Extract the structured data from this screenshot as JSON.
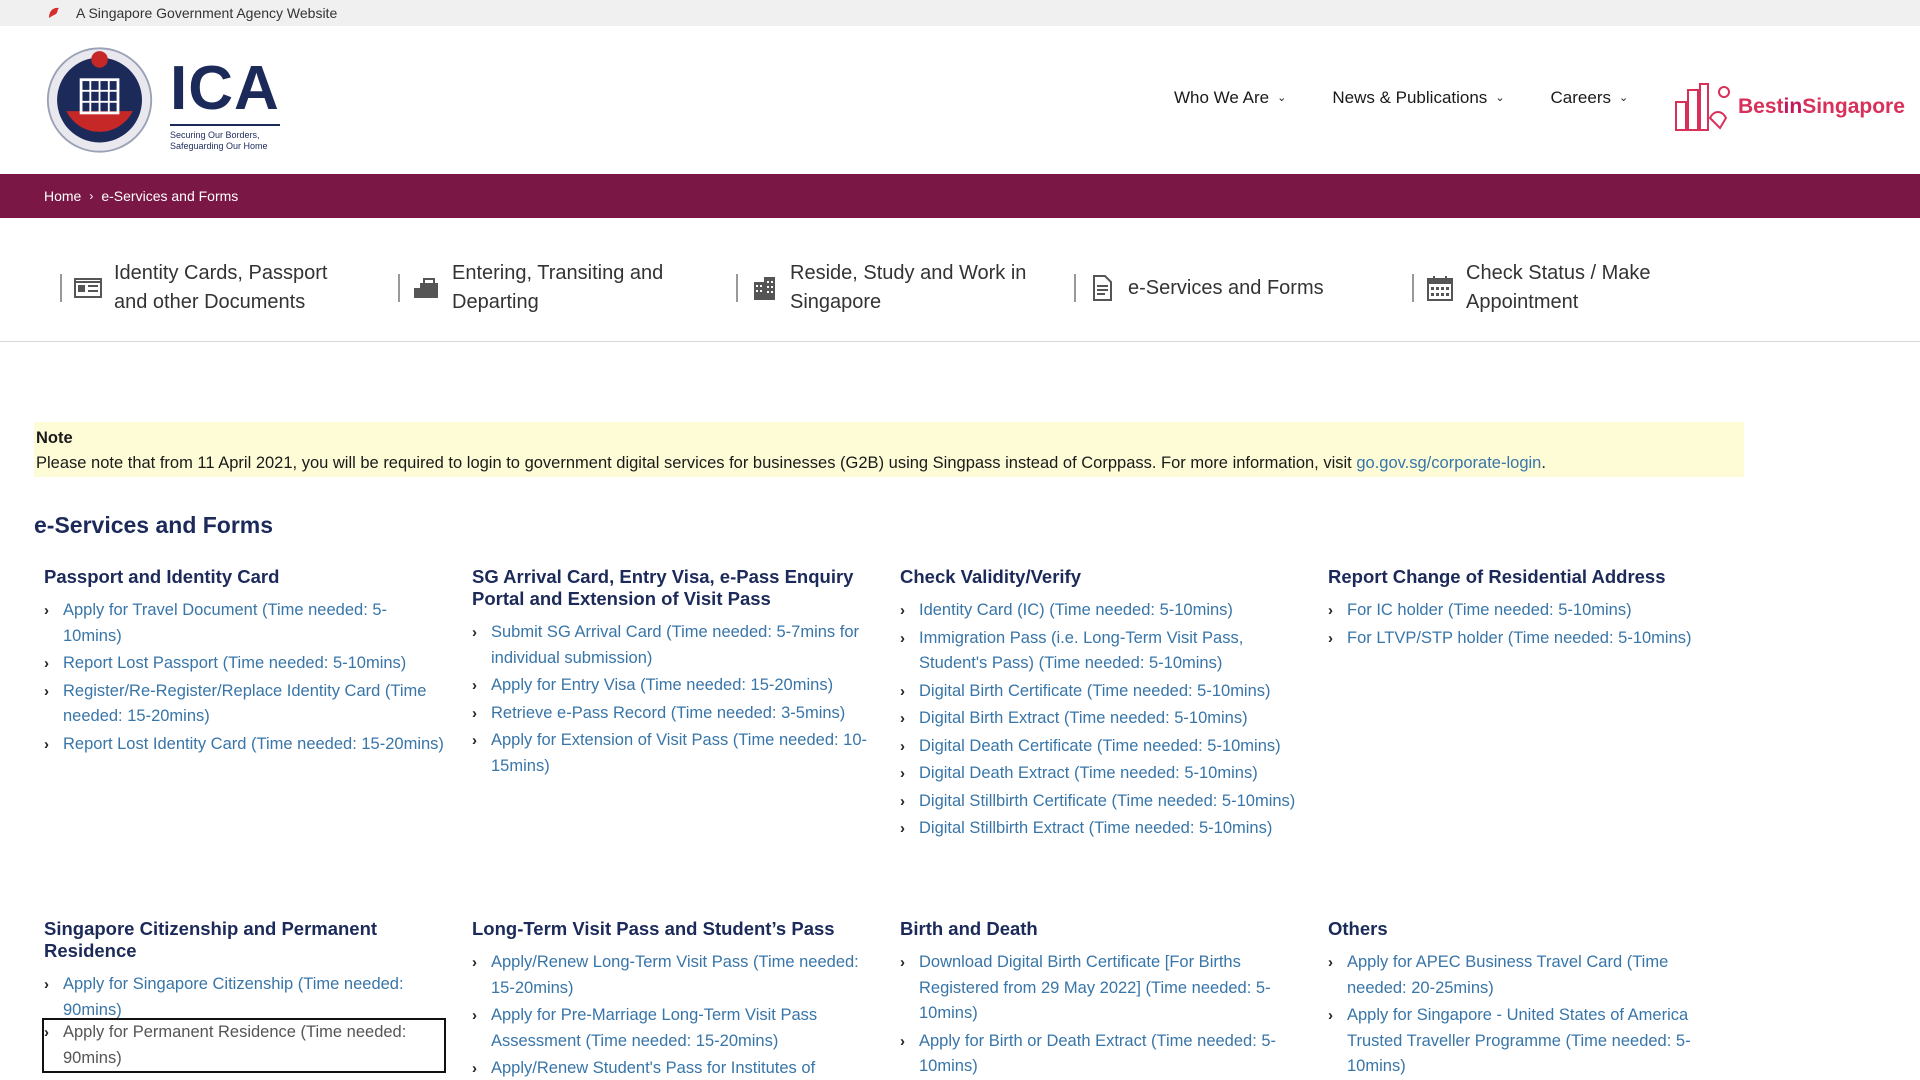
{
  "gov_bar": {
    "text": "A Singapore Government Agency Website"
  },
  "header": {
    "logo_abbr": "ICA",
    "logo_tagline_1": "Securing Our Borders,",
    "logo_tagline_2": "Safeguarding Our Home",
    "nav": [
      "Who We Are",
      "News & Publications",
      "Careers"
    ],
    "campaign_best": "Best",
    "campaign_in": "in",
    "campaign_singapore": "Singapore"
  },
  "breadcrumb": {
    "home": "Home",
    "current": "e-Services and Forms"
  },
  "categories": [
    {
      "line1": "Identity Cards, Passport",
      "line2": "and other Documents",
      "icon": "id-card-icon"
    },
    {
      "line1": "Entering, Transiting and",
      "line2": "Departing",
      "icon": "luggage-icon"
    },
    {
      "line1": "Reside, Study and Work in",
      "line2": "Singapore",
      "icon": "building-icon"
    },
    {
      "line1": "e-Services and Forms",
      "line2": "",
      "icon": "document-icon"
    },
    {
      "line1": "Check Status / Make",
      "line2": "Appointment",
      "icon": "calendar-icon"
    }
  ],
  "note": {
    "title": "Note",
    "text": "Please note that from 11 April 2021, you will be required to login to government digital services for businesses (G2B) using Singpass instead of Corppass. For more information, visit ",
    "link": "go.gov.sg/corporate-login",
    "end": "."
  },
  "section_title": "e-Services and Forms",
  "groups": [
    {
      "title": "Passport and Identity Card",
      "items": [
        "Apply for Travel Document (Time needed: 5-10mins)",
        "Report Lost Passport (Time needed: 5-10mins)",
        "Register/Re-Register/Replace Identity Card (Time needed: 15-20mins)",
        "Report Lost Identity Card (Time needed: 15-20mins)"
      ]
    },
    {
      "title": "SG Arrival Card, Entry Visa, e-Pass Enquiry Portal and Extension of Visit Pass",
      "items": [
        "Submit SG Arrival Card (Time needed: 5-7mins for individual submission)",
        "Apply for Entry Visa (Time needed: 15-20mins)",
        "Retrieve e-Pass Record (Time needed: 3-5mins)",
        "Apply for Extension of Visit Pass (Time needed: 10-15mins)"
      ]
    },
    {
      "title": "Check Validity/Verify",
      "items": [
        "Identity Card (IC) (Time needed: 5-10mins)",
        "Immigration Pass (i.e. Long-Term Visit Pass, Student's Pass) (Time needed: 5-10mins)",
        "Digital Birth Certificate (Time needed: 5-10mins)",
        "Digital Birth Extract (Time needed: 5-10mins)",
        "Digital Death Certificate (Time needed: 5-10mins)",
        "Digital Death Extract (Time needed: 5-10mins)",
        "Digital Stillbirth Certificate (Time needed: 5-10mins)",
        "Digital Stillbirth Extract (Time needed: 5-10mins)"
      ]
    },
    {
      "title": "Report Change of Residential Address",
      "items": [
        "For IC holder (Time needed: 5-10mins)",
        "For LTVP/STP holder (Time needed: 5-10mins)"
      ]
    },
    {
      "title": "Singapore Citizenship and Permanent Residence",
      "items": [
        "Apply for Singapore Citizenship (Time needed: 90mins)",
        "Apply for Permanent Residence (Time needed: 90mins)"
      ]
    },
    {
      "title": "Long-Term Visit Pass and Student’s Pass",
      "items": [
        "Apply/Renew Long-Term Visit Pass (Time needed: 15-20mins)",
        "Apply for Pre-Marriage Long-Term Visit Pass Assessment (Time needed: 15-20mins)",
        "Apply/Renew Student's Pass for Institutes of"
      ]
    },
    {
      "title": "Birth and Death",
      "items": [
        "Download Digital Birth Certificate [For Births Registered from 29 May 2022] (Time needed: 5-10mins)",
        "Apply for Birth or Death Extract (Time needed: 5-10mins)"
      ]
    },
    {
      "title": "Others",
      "items": [
        "Apply for APEC Business Travel Card (Time needed: 20-25mins)",
        "Apply for Singapore - United States of America Trusted Traveller Programme (Time needed: 5-10mins)"
      ]
    }
  ]
}
